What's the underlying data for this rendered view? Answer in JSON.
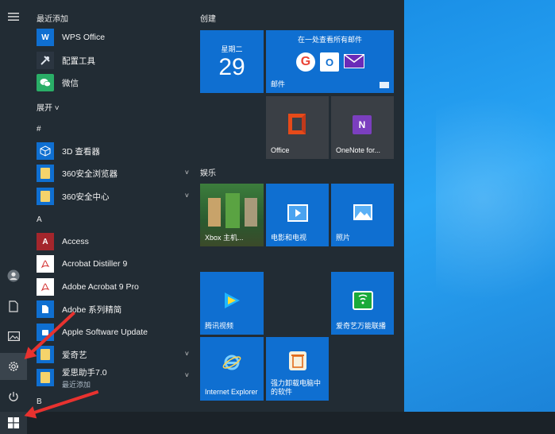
{
  "start_menu": {
    "recent_header": "最近添加",
    "recent_apps": [
      {
        "label": "WPS Office",
        "icon": "wps-icon"
      },
      {
        "label": "配置工具",
        "icon": "tools-icon"
      },
      {
        "label": "微信",
        "icon": "wechat-icon"
      }
    ],
    "expand_label": "展开 ˅",
    "sections": {
      "hash": "#",
      "a": "A",
      "b": "B"
    },
    "hash_apps": [
      {
        "label": "3D 查看器",
        "icon": "cube-icon"
      },
      {
        "label": "360安全浏览器",
        "icon": "folder-icon",
        "chevron": "˅"
      },
      {
        "label": "360安全中心",
        "icon": "folder-icon",
        "chevron": "˅"
      }
    ],
    "a_apps": [
      {
        "label": "Access",
        "icon": "access-icon"
      },
      {
        "label": "Acrobat Distiller 9",
        "icon": "pdf-icon"
      },
      {
        "label": "Adobe Acrobat 9 Pro",
        "icon": "pdf-icon"
      },
      {
        "label": "Adobe 系列精简",
        "icon": "document-icon"
      },
      {
        "label": "Apple Software Update",
        "icon": "apple-icon"
      },
      {
        "label": "爱奇艺",
        "icon": "folder-icon",
        "chevron": "˅"
      },
      {
        "label": "爱思助手7.0",
        "sub": "最近添加",
        "icon": "folder-icon",
        "chevron": "˅"
      }
    ],
    "rail": [
      "menu-icon",
      "user-icon",
      "document-icon",
      "pictures-icon",
      "settings-icon",
      "power-icon"
    ]
  },
  "tiles": {
    "create_header": "创建",
    "entertainment_header": "娱乐",
    "calendar": {
      "weekday": "星期二",
      "day": "29"
    },
    "mail": {
      "caption": "在一处查看所有邮件",
      "label": "邮件"
    },
    "office": {
      "label": "Office"
    },
    "onenote": {
      "label": "OneNote for..."
    },
    "xbox": {
      "label": "Xbox 主机..."
    },
    "movies": {
      "label": "电影和电视"
    },
    "photos": {
      "label": "照片"
    },
    "tencent_video": {
      "label": "腾讯视频"
    },
    "iqiyi_cast": {
      "label": "爱奇艺万能联播"
    },
    "ie": {
      "label": "Internet Explorer"
    },
    "uninstall": {
      "label": "强力卸载电脑中的软件"
    }
  },
  "colors": {
    "tile_blue": "#0f6fd1",
    "menu_bg": "#222c34",
    "arrow_red": "#e8322f"
  }
}
